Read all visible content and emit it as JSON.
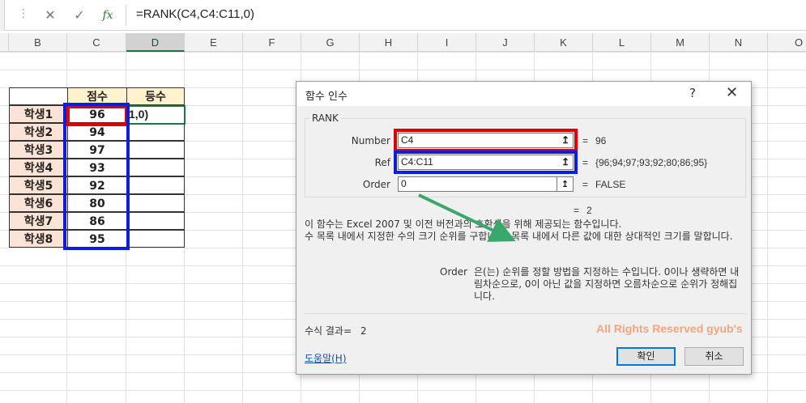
{
  "formula_bar": {
    "dots": "⋮",
    "cancel": "✕",
    "enter": "✓",
    "fx": "fx",
    "formula": "=RANK(C4,C4:C11,0)"
  },
  "columns": [
    "B",
    "C",
    "D",
    "E",
    "F",
    "G",
    "H",
    "I",
    "J",
    "K",
    "L",
    "M",
    "N",
    "O"
  ],
  "selected_column": "D",
  "table": {
    "header_score": "점수",
    "header_rank": "등수",
    "names": [
      "학생1",
      "학생2",
      "학생3",
      "학생4",
      "학생5",
      "학생6",
      "학생7",
      "학생8"
    ],
    "scores": [
      "96",
      "94",
      "97",
      "93",
      "92",
      "80",
      "86",
      "95"
    ],
    "rank_edit": "1,0)"
  },
  "dialog": {
    "title": "함수 인수",
    "help_button": "?",
    "close_button": "✕",
    "function_name": "RANK",
    "args": [
      {
        "label": "Number",
        "value": "C4",
        "result": "96"
      },
      {
        "label": "Ref",
        "value": "C4:C11",
        "result": "{96;94;97;93;92;80;86;95}"
      },
      {
        "label": "Order",
        "value": "0",
        "result": "FALSE"
      }
    ],
    "equals": "=",
    "ref_icon": "↥",
    "overall_result": "2",
    "description_1": "이 함수는 Excel 2007 및 이전 버전과의 호환성을 위해 제공되는 함수입니다.",
    "description_2": "수 목록 내에서 지정한 수의 크기 순위를 구합니다. 목록 내에서 다른 값에 대한 상대적인 크기를 말합니다.",
    "arg_help_name": "Order",
    "arg_help_text": "은(는) 순위를 정할 방법을 지정하는 수입니다. 0이나 생략하면 내림차순으로, 0이 아닌 값을 지정하면 오름차순으로 순위가 정해집니다.",
    "formula_result_label": "수식 결과=",
    "formula_result_value": "2",
    "help_link": "도움말(H)",
    "ok_button": "확인",
    "cancel_button": "취소",
    "watermark": "All Rights Reserved gyub's"
  },
  "colors": {
    "highlight_red": "#e00000",
    "highlight_blue": "#0a1fd6",
    "arrow_green": "#3aa86b",
    "excel_green": "#217346"
  }
}
